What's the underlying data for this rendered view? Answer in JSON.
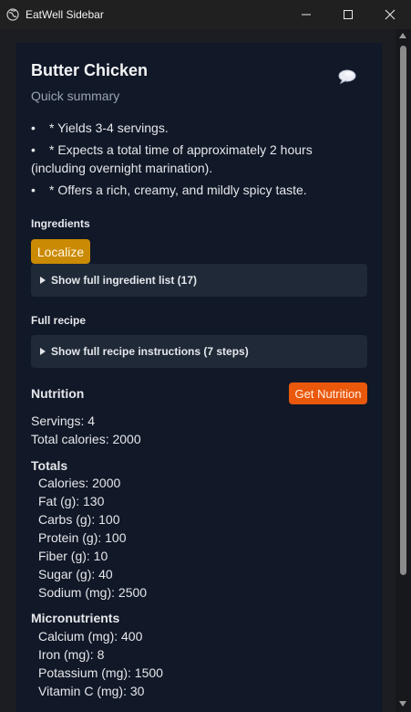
{
  "window": {
    "title": "EatWell Sidebar"
  },
  "recipe": {
    "title": "Butter Chicken",
    "subtitle": "Quick summary",
    "summary": [
      "* Yields 3-4 servings.",
      "* Expects a total time of approximately 2 hours (including overnight marination).",
      "* Offers a rich, creamy, and mildly spicy taste."
    ]
  },
  "ingredients": {
    "heading": "Ingredients",
    "localize_label": "Localize",
    "toggle_label": "Show full ingredient list (17)"
  },
  "full_recipe": {
    "heading": "Full recipe",
    "toggle_label": "Show full recipe instructions (7 steps)"
  },
  "nutrition": {
    "heading": "Nutrition",
    "button_label": "Get Nutrition",
    "servings": "Servings: 4",
    "total_calories": "Total calories: 2000",
    "totals_heading": "Totals",
    "totals": [
      "Calories: 2000",
      "Fat (g): 130",
      "Carbs (g): 100",
      "Protein (g): 100",
      "Fiber (g): 10",
      "Sugar (g): 40",
      "Sodium (mg): 2500"
    ],
    "micro_heading": "Micronutrients",
    "micronutrients": [
      "Calcium (mg): 400",
      "Iron (mg): 8",
      "Potassium (mg): 1500",
      "Vitamin C (mg): 30"
    ]
  },
  "colors": {
    "panel_bg": "#111827",
    "localize_button": "#ca8a04",
    "nutrition_button": "#ea580c"
  },
  "icons": {
    "app": "globe-icon",
    "chat": "speech-bubble-icon"
  }
}
